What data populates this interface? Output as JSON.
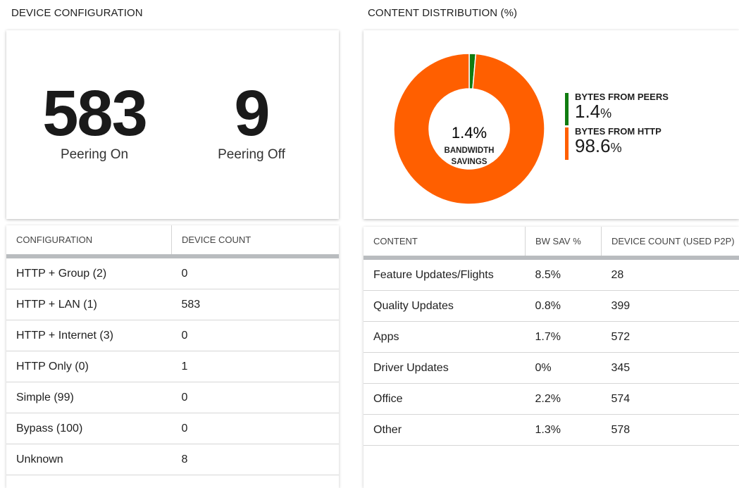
{
  "device_configuration": {
    "title": "DEVICE CONFIGURATION",
    "peering_on": {
      "value": "583",
      "label": "Peering On"
    },
    "peering_off": {
      "value": "9",
      "label": "Peering Off"
    },
    "table": {
      "headers": [
        "CONFIGURATION",
        "DEVICE COUNT"
      ],
      "rows": [
        [
          "HTTP + Group (2)",
          "0"
        ],
        [
          "HTTP + LAN (1)",
          "583"
        ],
        [
          "HTTP + Internet (3)",
          "0"
        ],
        [
          "HTTP Only (0)",
          "1"
        ],
        [
          "Simple (99)",
          "0"
        ],
        [
          "Bypass (100)",
          "0"
        ],
        [
          "Unknown",
          "8"
        ]
      ]
    }
  },
  "content_distribution": {
    "title": "CONTENT DISTRIBUTION (%)",
    "donut": {
      "center_value": "1.4%",
      "center_label_line1": "BANDWIDTH",
      "center_label_line2": "SAVINGS"
    },
    "legend": [
      {
        "label": "BYTES FROM PEERS",
        "value": "1.4",
        "unit": "%",
        "color": "#107c10"
      },
      {
        "label": "BYTES FROM HTTP",
        "value": "98.6",
        "unit": "%",
        "color": "#ff5f00"
      }
    ],
    "table": {
      "headers": [
        "CONTENT",
        "BW SAV %",
        "DEVICE COUNT (USED P2P)"
      ],
      "rows": [
        [
          "Feature Updates/Flights",
          "8.5%",
          "28"
        ],
        [
          "Quality Updates",
          "0.8%",
          "399"
        ],
        [
          "Apps",
          "1.7%",
          "572"
        ],
        [
          "Driver Updates",
          "0%",
          "345"
        ],
        [
          "Office",
          "2.2%",
          "574"
        ],
        [
          "Other",
          "1.3%",
          "578"
        ]
      ]
    }
  },
  "chart_data": {
    "type": "pie",
    "categories": [
      "BYTES FROM PEERS",
      "BYTES FROM HTTP"
    ],
    "values": [
      1.4,
      98.6
    ],
    "colors": [
      "#107c10",
      "#ff5f00"
    ],
    "title": "CONTENT DISTRIBUTION (%)"
  }
}
